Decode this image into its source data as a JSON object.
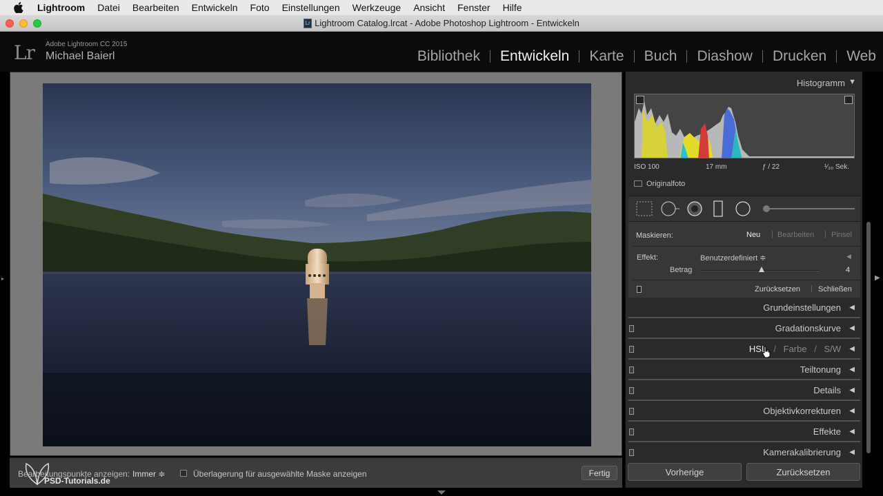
{
  "menubar": {
    "items": [
      "Lightroom",
      "Datei",
      "Bearbeiten",
      "Entwickeln",
      "Foto",
      "Einstellungen",
      "Werkzeuge",
      "Ansicht",
      "Fenster",
      "Hilfe"
    ]
  },
  "window": {
    "title": "Lightroom Catalog.lrcat - Adobe Photoshop Lightroom - Entwickeln",
    "doc_icon": "Lr"
  },
  "identity": {
    "logo": "Lr",
    "product": "Adobe Lightroom CC 2015",
    "user": "Michael Baierl"
  },
  "modules": {
    "items": [
      "Bibliothek",
      "Entwickeln",
      "Karte",
      "Buch",
      "Diashow",
      "Drucken",
      "Web"
    ],
    "active": "Entwickeln"
  },
  "toolbar": {
    "pins_label": "Bearbeitungspunkte anzeigen:",
    "pins_value": "Immer ≑",
    "overlay_label": "Überlagerung für ausgewählte Maske anzeigen",
    "done_label": "Fertig",
    "watermark": "PSD-Tutorials.de"
  },
  "histogram": {
    "title": "Histogramm",
    "iso": "ISO 100",
    "focal": "17 mm",
    "aperture": "ƒ / 22",
    "shutter": "¹⁄₃₀ Sek.",
    "original_label": "Originalfoto"
  },
  "mask": {
    "label": "Maskieren:",
    "new": "Neu",
    "edit": "Bearbeiten",
    "brush": "Pinsel",
    "effect_label": "Effekt:",
    "effect_value": "Benutzerdefiniert ≑",
    "amount_label": "Betrag",
    "amount_value": "4",
    "amount_fraction": 0.52,
    "reset": "Zurücksetzen",
    "close": "Schließen"
  },
  "panels": {
    "basic": "Grundeinstellungen",
    "tone_curve": "Gradationskurve",
    "hsl": "HSL",
    "color": "Farbe",
    "bw": "S/W",
    "slash": "/",
    "split_toning": "Teiltonung",
    "details": "Details",
    "lens": "Objektivkorrekturen",
    "effects": "Effekte",
    "calibration": "Kamerakalibrierung"
  },
  "buttons": {
    "previous": "Vorherige",
    "reset": "Zurücksetzen"
  },
  "colors": {
    "accent": "#f2f2f2",
    "panel": "#2a2a2a",
    "photo_bg": "#7a7a7a"
  }
}
